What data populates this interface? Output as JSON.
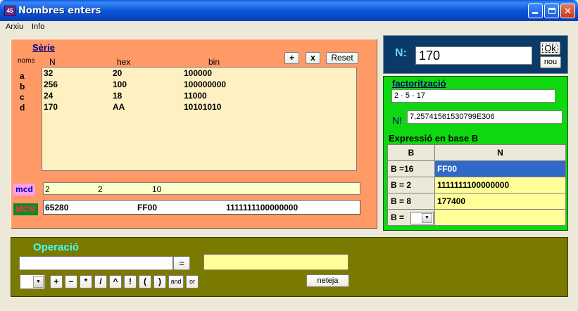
{
  "window": {
    "title": "Nombres enters",
    "icon": "app-icon"
  },
  "menu": {
    "items": [
      "Arxiu",
      "Info"
    ]
  },
  "serie": {
    "title": "Sèrie",
    "headers": {
      "noms": "noms",
      "n": "N",
      "hex": "hex",
      "bin": "bin"
    },
    "names": [
      "a",
      "b",
      "c",
      "d"
    ],
    "rows": [
      {
        "n": "32",
        "hex": "20",
        "bin": "100000"
      },
      {
        "n": "256",
        "hex": "100",
        "bin": "100000000"
      },
      {
        "n": "24",
        "hex": "18",
        "bin": "11000"
      },
      {
        "n": "170",
        "hex": "AA",
        "bin": "10101010"
      }
    ],
    "buttons": {
      "add": "+",
      "remove": "x",
      "reset": "Reset"
    }
  },
  "mcd": {
    "label": "mcd",
    "n": "2",
    "hex": "2",
    "bin": "10"
  },
  "mcm": {
    "label": "MCM",
    "n": "65280",
    "hex": "FF00",
    "bin": "1111111100000000"
  },
  "n_panel": {
    "label": "N:",
    "value": "170",
    "ok_label": "Ok",
    "nou_label": "nou"
  },
  "factoritzacio": {
    "title": "factorització",
    "value": "2 · 5 · 17",
    "nfact_label": "N!",
    "nfact_value": "7,25741561530799E306"
  },
  "expressio": {
    "title": "Expressió en base B",
    "headers": {
      "b": "B",
      "n": "N"
    },
    "rows": [
      {
        "base": "B =16",
        "value": "FF00",
        "selected": true
      },
      {
        "base": "B = 2",
        "value": "1111111100000000"
      },
      {
        "base": "B = 8",
        "value": "177400"
      },
      {
        "base": "B =",
        "value": ""
      }
    ]
  },
  "operacio": {
    "title": "Operació",
    "input_value": "",
    "equals_label": "=",
    "result": "",
    "operators": [
      "+",
      "−",
      "*",
      "/",
      "^",
      "!",
      "(",
      ")",
      "and",
      "or"
    ],
    "clear_label": "neteja"
  },
  "colors": {
    "serie_bg": "#FF9966",
    "list_bg": "#FFF0C2",
    "n_panel_bg": "#0A3A68",
    "fact_bg": "#10D810",
    "op_bg": "#7A7A00",
    "selected": "#3169C6"
  }
}
